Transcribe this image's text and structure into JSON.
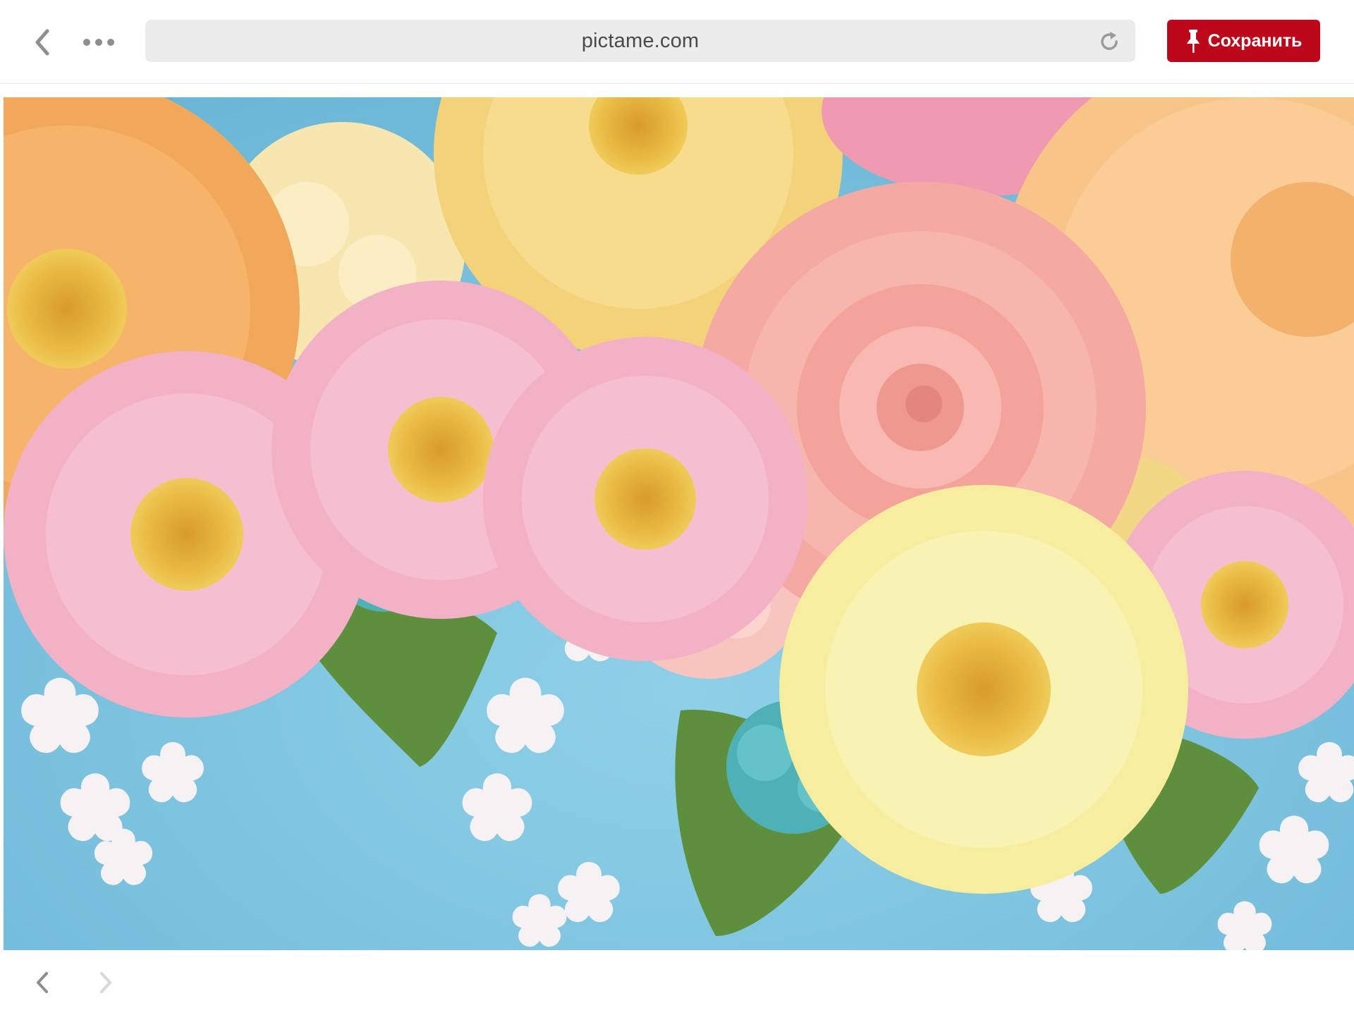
{
  "toolbar": {
    "back_icon": "chevron-left-icon",
    "more_icon": "more-dots-icon",
    "address": {
      "url": "pictame.com",
      "reload_icon": "reload-icon"
    },
    "save_button": {
      "label": "Сохранить",
      "icon": "pin-icon",
      "color": "#bd081c"
    }
  },
  "photo": {
    "subject": "paper flowers",
    "colors": {
      "background": "#79c1de",
      "orange": "#f2a85a",
      "peach": "#f8c487",
      "yellow": "#f4d27a",
      "cream": "#f7e6b0",
      "pale_yellow": "#f6ee9e",
      "pink": "#f3b1c6",
      "rose": "#f4a9a2",
      "blush": "#f7c5bd",
      "teal": "#4fb1b8",
      "leaf": "#5e8f3c",
      "white_petal": "#f6f2f3",
      "stamen": "#e7b43b"
    }
  },
  "footer": {
    "prev_icon": "chevron-left-icon",
    "next_icon": "chevron-right-icon"
  }
}
